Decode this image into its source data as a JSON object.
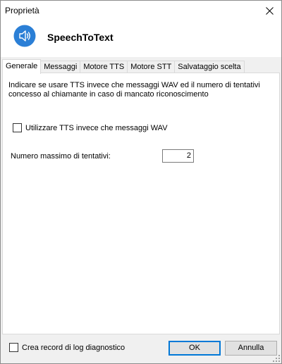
{
  "window": {
    "title": "Proprietà",
    "close_icon": "close-icon"
  },
  "header": {
    "app_name": "SpeechToText",
    "app_icon": "speaker-icon",
    "accent": "#2b7fd6"
  },
  "tabs": [
    {
      "label": "Generale",
      "active": true
    },
    {
      "label": "Messaggi",
      "active": false
    },
    {
      "label": "Motore TTS",
      "active": false
    },
    {
      "label": "Motore STT",
      "active": false
    },
    {
      "label": "Salvataggio scelta",
      "active": false
    }
  ],
  "general": {
    "description": "Indicare se usare TTS invece che messaggi WAV ed il numero di tentativi concesso al chiamante in caso di mancato riconoscimento",
    "tts_checkbox_label": "Utilizzare TTS invece che messaggi WAV",
    "tts_checked": false,
    "retry_label": "Numero massimo di tentativi:",
    "retry_value": "2"
  },
  "footer": {
    "log_checkbox_label": "Crea record di log diagnostico",
    "log_checked": false,
    "ok_label": "OK",
    "cancel_label": "Annulla"
  }
}
